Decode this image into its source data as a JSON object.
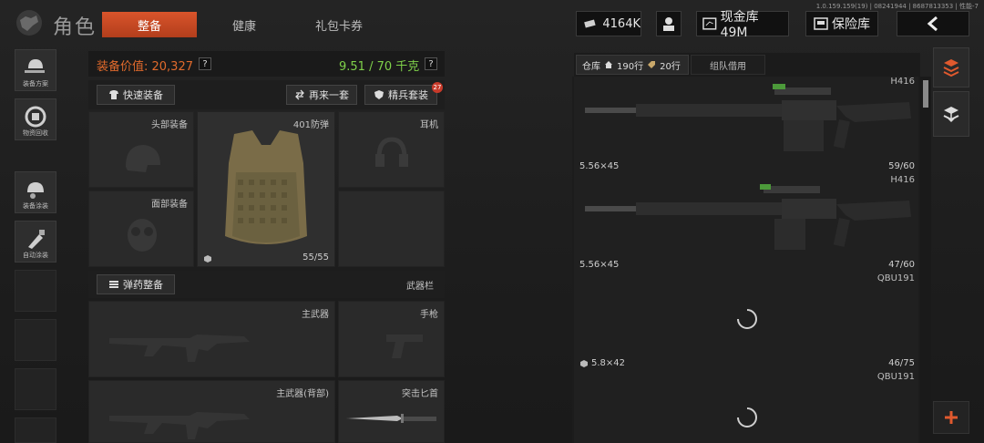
{
  "header": {
    "title": "角色",
    "tabs": [
      "整备",
      "健康",
      "礼包卡券"
    ],
    "active_tab": 0,
    "version": "1.0.159.159(19) | 08241944 | 8687813353 | 性能-7",
    "currency": "4164K",
    "cash_store": "现金库 49M",
    "insurance": "保险库"
  },
  "sidebar": {
    "items": [
      {
        "label": "装备方案",
        "icon": "gun-helmet-icon"
      },
      {
        "label": "物资回收",
        "icon": "recycle-icon"
      },
      {
        "label": "装备涂装",
        "icon": "paint-helmet-icon"
      },
      {
        "label": "自动涂装",
        "icon": "brush-icon"
      }
    ]
  },
  "loadout": {
    "value_label": "装备价值: 20,327",
    "weight": "9.51 / 70 千克",
    "quick_equip": "快速装备",
    "again": "再来一套",
    "elite": "精兵套装",
    "elite_badge": "27",
    "slots": {
      "head": "头部装备",
      "face": "面部装备",
      "armor": "401防弹",
      "armor_durability": "55/55",
      "headset": "耳机",
      "ammo_prep": "弹药整备",
      "weapon_bar": "武器栏",
      "primary": "主武器",
      "pistol": "手枪",
      "primary_back": "主武器(背部)",
      "knife": "突击匕首"
    }
  },
  "warehouse": {
    "tab": "仓库",
    "rows1": "190行",
    "rows2": "20行",
    "team": "组队借用",
    "items": [
      {
        "name": "H416",
        "caliber": "5.56×45",
        "count": "59/60"
      },
      {
        "name": "H416",
        "caliber": "5.56×45",
        "count": "47/60"
      },
      {
        "name": "QBU191",
        "caliber": "5.8×42",
        "count": "46/75"
      },
      {
        "name": "QBU191",
        "caliber": "",
        "count": ""
      }
    ]
  },
  "colors": {
    "accent": "#d9542b",
    "value_orange": "#e06a2c",
    "weight_green": "#7fd14a"
  }
}
